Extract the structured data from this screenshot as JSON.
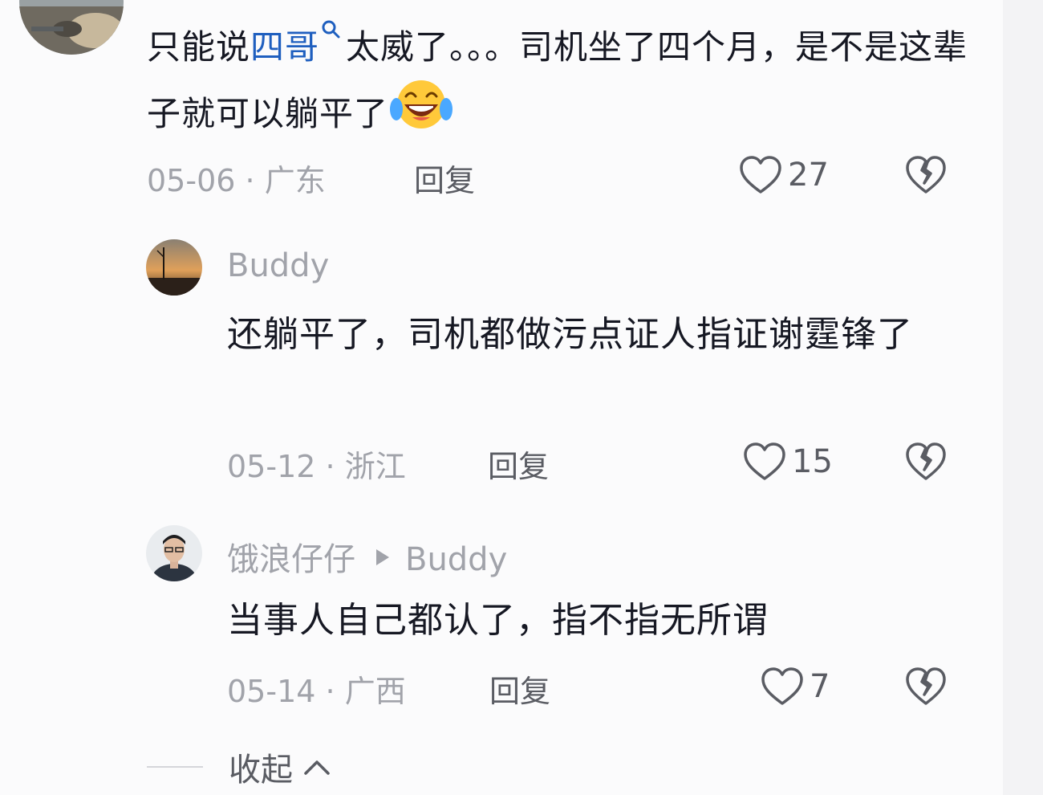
{
  "comment": {
    "text_before_link": "只能说",
    "link_text": "四哥",
    "text_after_link": "太威了。。。司机坐了四个月，是不是这辈子就可以躺平了",
    "emoji": "laughing-tears-emoji",
    "date": "05-06",
    "location": "广东",
    "reply_label": "回复",
    "likes": "27"
  },
  "replies": [
    {
      "username": "Buddy",
      "reply_to": "",
      "text": "还躺平了，司机都做污点证人指证谢霆锋了",
      "date": "05-12",
      "location": "浙江",
      "reply_label": "回复",
      "likes": "15"
    },
    {
      "username": "饿浪仔仔",
      "reply_to": "Buddy",
      "text": "当事人自己都认了，指不指无所谓",
      "date": "05-14",
      "location": "广西",
      "reply_label": "回复",
      "likes": "7"
    }
  ],
  "collapse_label": "收起",
  "icons": {
    "like": "heart-outline-icon",
    "dislike": "broken-heart-icon",
    "search": "search-icon",
    "collapse": "chevron-up-icon"
  },
  "colors": {
    "link": "#1f5fbf",
    "muted": "#a1a3aa",
    "text": "#161823"
  }
}
